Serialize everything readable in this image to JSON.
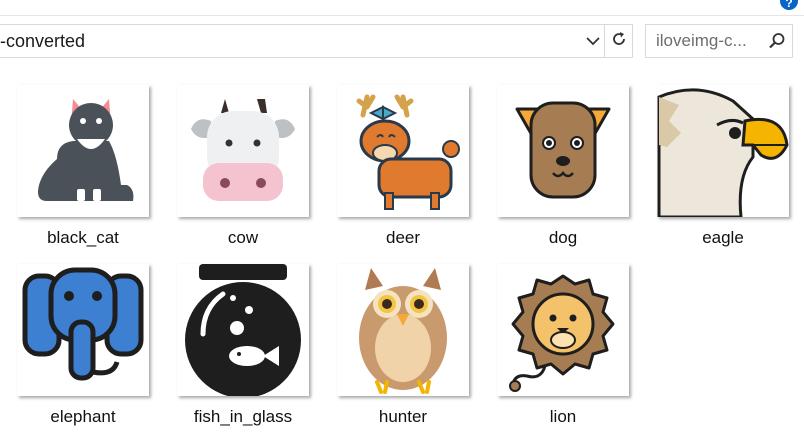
{
  "window": {
    "address_path": "-converted",
    "help_label": "?"
  },
  "search": {
    "placeholder": "iloveimg-c..."
  },
  "icons": {
    "dropdown": "chevron-down-icon",
    "refresh": "refresh-icon",
    "search": "search-icon",
    "help": "help-icon"
  },
  "files": [
    {
      "name": "black_cat",
      "thumbnail": "black-cat"
    },
    {
      "name": "cow",
      "thumbnail": "cow"
    },
    {
      "name": "deer",
      "thumbnail": "deer"
    },
    {
      "name": "dog",
      "thumbnail": "dog"
    },
    {
      "name": "eagle",
      "thumbnail": "eagle"
    },
    {
      "name": "elephant",
      "thumbnail": "elephant"
    },
    {
      "name": "fish_in_glass",
      "thumbnail": "fish-in-glass"
    },
    {
      "name": "hunter",
      "thumbnail": "owl"
    },
    {
      "name": "lion",
      "thumbnail": "lion"
    }
  ]
}
